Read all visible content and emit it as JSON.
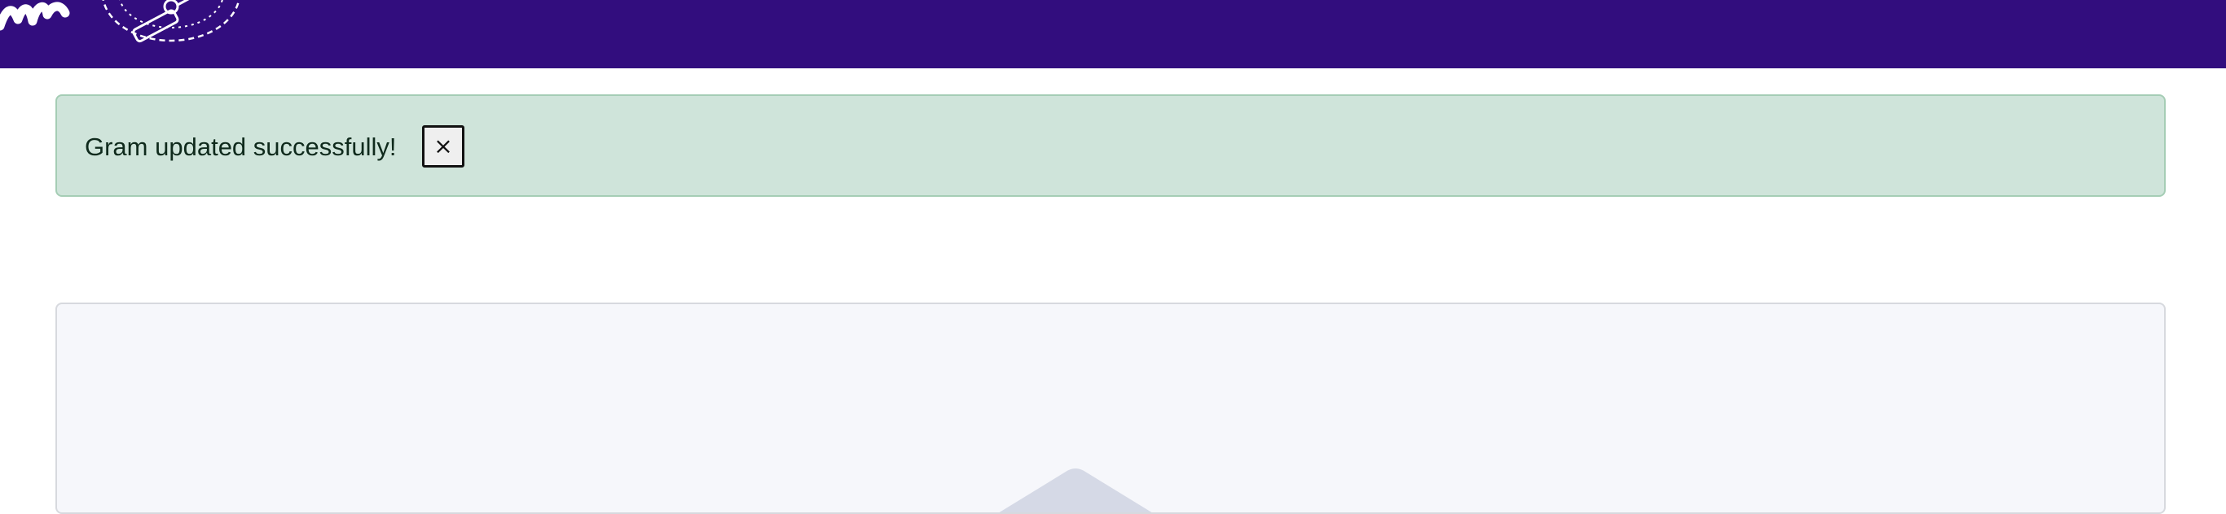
{
  "header": {
    "background_color": "#320d7e",
    "logo_icon": "wordmark-logo",
    "emblem_icon": "ticket-emblem-icon"
  },
  "alert": {
    "message": "Gram updated successfully!",
    "close_label": "×",
    "background_color": "#cfe4da",
    "border_color": "#a5cdb5"
  },
  "media": {
    "placeholder_icon": "image-placeholder-icon",
    "background_color": "#f6f7fb"
  }
}
